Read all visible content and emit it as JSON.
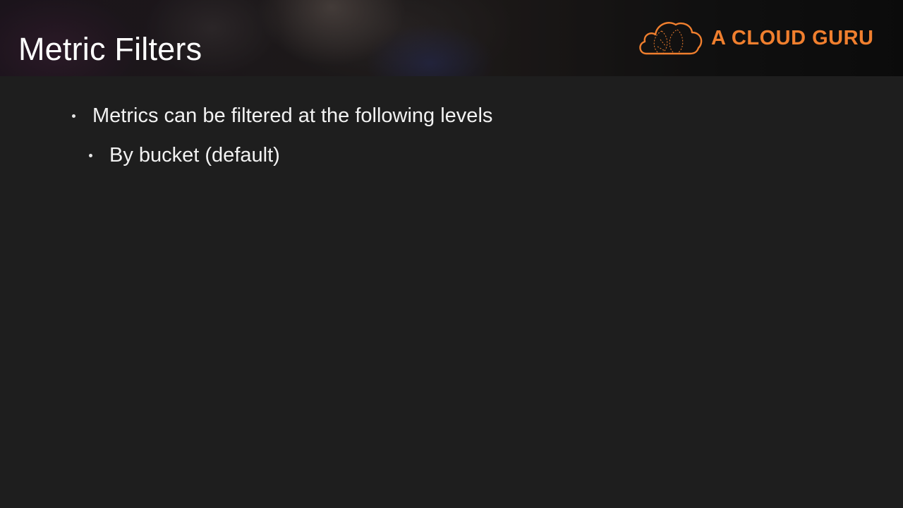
{
  "slide": {
    "title": "Metric Filters",
    "brand": {
      "name": "A CLOUD GURU",
      "logo_icon": "cloud-logo-icon",
      "color": "#f07f2e"
    },
    "bullets": [
      {
        "text": "Metrics can be filtered at the following levels",
        "level": 1
      },
      {
        "text": "By bucket (default)",
        "level": 2
      }
    ],
    "colors": {
      "background": "#1e1e1e",
      "text": "#f2f2f2",
      "accent": "#f07f2e"
    }
  }
}
